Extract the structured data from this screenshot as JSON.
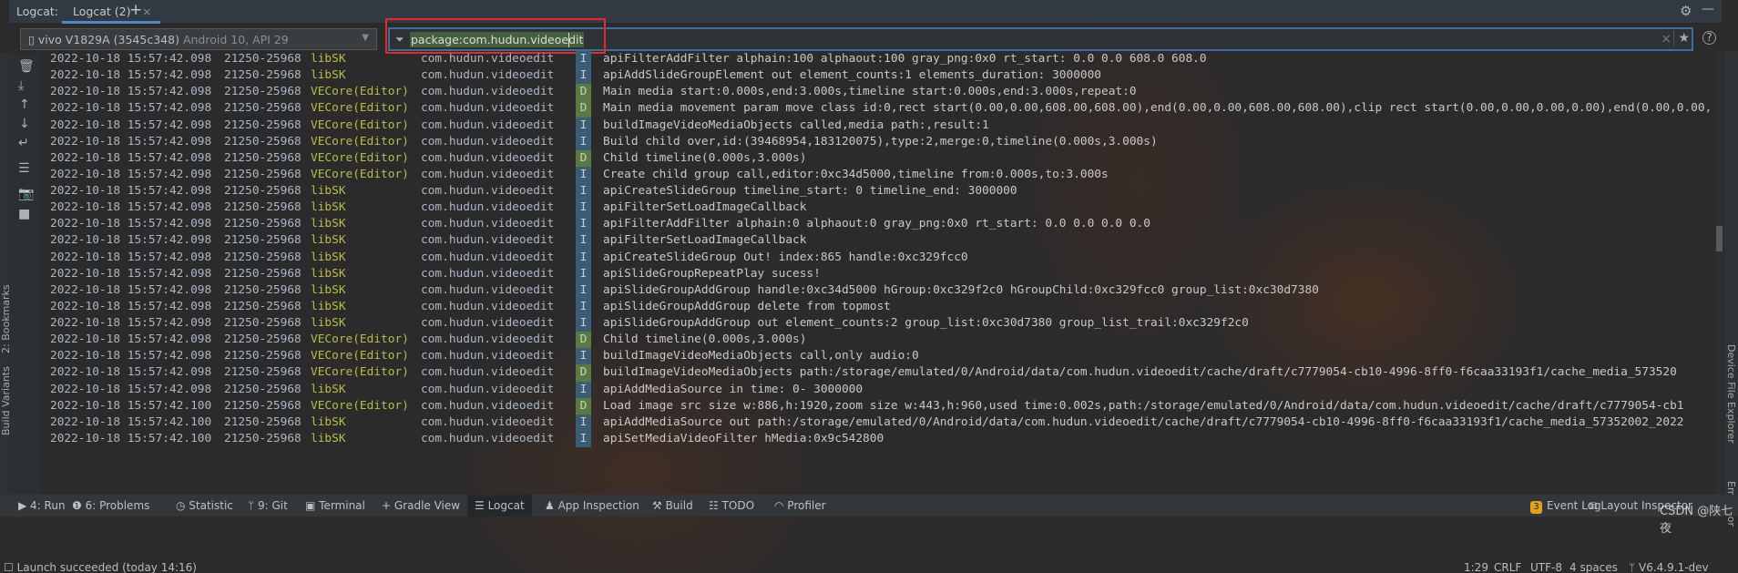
{
  "tabs": {
    "prefix": "Logcat:",
    "active": "Logcat (2)",
    "close": "×",
    "add": "+"
  },
  "header_icons": {
    "settings": "gear-icon",
    "minimize": "minimize-icon"
  },
  "device": {
    "name": "vivo V1829A (3545c348)",
    "os": "Android 10, API 29"
  },
  "filter": {
    "value": "package:com.hudun.videoedit",
    "highlight_color": "#e8282a"
  },
  "left_stripe": {
    "bookmarks": "2: Bookmarks",
    "build_variants": "Build Variants"
  },
  "right_stripe": {
    "device_file_explorer": "Device File Explorer",
    "emulator": "Emulator"
  },
  "log_rows": [
    {
      "date": "2022-10-18 15:57:42.098",
      "pid": "21250-25968",
      "tag": "libSK",
      "pkg": "com.hudun.videoedit",
      "level": "I",
      "msg": "apiFilterAddFilter alphain:100 alphaout:100 gray_png:0x0 rt_start: 0.0 0.0 608.0 608.0"
    },
    {
      "date": "2022-10-18 15:57:42.098",
      "pid": "21250-25968",
      "tag": "libSK",
      "pkg": "com.hudun.videoedit",
      "level": "I",
      "msg": "apiAddSlideGroupElement out element_counts:1 elements_duration: 3000000"
    },
    {
      "date": "2022-10-18 15:57:42.098",
      "pid": "21250-25968",
      "tag": "VECore(Editor)",
      "pkg": "com.hudun.videoedit",
      "level": "D",
      "msg": "Main media start:0.000s,end:3.000s,timeline start:0.000s,end:3.000s,repeat:0"
    },
    {
      "date": "2022-10-18 15:57:42.098",
      "pid": "21250-25968",
      "tag": "VECore(Editor)",
      "pkg": "com.hudun.videoedit",
      "level": "D",
      "msg": "Main media movement param move class id:0,rect start(0.00,0.00,608.00,608.00),end(0.00,0.00,608.00,608.00),clip rect start(0.00,0.00,0.00,0.00),end(0.00,0.00,"
    },
    {
      "date": "2022-10-18 15:57:42.098",
      "pid": "21250-25968",
      "tag": "VECore(Editor)",
      "pkg": "com.hudun.videoedit",
      "level": "I",
      "msg": "buildImageVideoMediaObjects called,media path:,result:1"
    },
    {
      "date": "2022-10-18 15:57:42.098",
      "pid": "21250-25968",
      "tag": "VECore(Editor)",
      "pkg": "com.hudun.videoedit",
      "level": "I",
      "msg": "Build child over,id:(39468954,183120075),type:2,merge:0,timeline(0.000s,3.000s)"
    },
    {
      "date": "2022-10-18 15:57:42.098",
      "pid": "21250-25968",
      "tag": "VECore(Editor)",
      "pkg": "com.hudun.videoedit",
      "level": "D",
      "msg": "Child timeline(0.000s,3.000s)"
    },
    {
      "date": "2022-10-18 15:57:42.098",
      "pid": "21250-25968",
      "tag": "VECore(Editor)",
      "pkg": "com.hudun.videoedit",
      "level": "I",
      "msg": "Create child group call,editor:0xc34d5000,timeline from:0.000s,to:3.000s"
    },
    {
      "date": "2022-10-18 15:57:42.098",
      "pid": "21250-25968",
      "tag": "libSK",
      "pkg": "com.hudun.videoedit",
      "level": "I",
      "msg": "apiCreateSlideGroup timeline_start: 0 timeline_end: 3000000"
    },
    {
      "date": "2022-10-18 15:57:42.098",
      "pid": "21250-25968",
      "tag": "libSK",
      "pkg": "com.hudun.videoedit",
      "level": "I",
      "msg": "apiFilterSetLoadImageCallback"
    },
    {
      "date": "2022-10-18 15:57:42.098",
      "pid": "21250-25968",
      "tag": "libSK",
      "pkg": "com.hudun.videoedit",
      "level": "I",
      "msg": "apiFilterAddFilter alphain:0 alphaout:0 gray_png:0x0 rt_start: 0.0 0.0 0.0 0.0"
    },
    {
      "date": "2022-10-18 15:57:42.098",
      "pid": "21250-25968",
      "tag": "libSK",
      "pkg": "com.hudun.videoedit",
      "level": "I",
      "msg": "apiFilterSetLoadImageCallback"
    },
    {
      "date": "2022-10-18 15:57:42.098",
      "pid": "21250-25968",
      "tag": "libSK",
      "pkg": "com.hudun.videoedit",
      "level": "I",
      "msg": "apiCreateSlideGroup Out! index:865 handle:0xc329fcc0"
    },
    {
      "date": "2022-10-18 15:57:42.098",
      "pid": "21250-25968",
      "tag": "libSK",
      "pkg": "com.hudun.videoedit",
      "level": "I",
      "msg": "apiSlideGroupRepeatPlay sucess!"
    },
    {
      "date": "2022-10-18 15:57:42.098",
      "pid": "21250-25968",
      "tag": "libSK",
      "pkg": "com.hudun.videoedit",
      "level": "I",
      "msg": "apiSlideGroupAddGroup handle:0xc34d5000 hGroup:0xc329f2c0 hGroupChild:0xc329fcc0 group_list:0xc30d7380"
    },
    {
      "date": "2022-10-18 15:57:42.098",
      "pid": "21250-25968",
      "tag": "libSK",
      "pkg": "com.hudun.videoedit",
      "level": "I",
      "msg": "apiSlideGroupAddGroup delete from topmost"
    },
    {
      "date": "2022-10-18 15:57:42.098",
      "pid": "21250-25968",
      "tag": "libSK",
      "pkg": "com.hudun.videoedit",
      "level": "I",
      "msg": "apiSlideGroupAddGroup out element_counts:2 group_list:0xc30d7380 group_list_trail:0xc329f2c0"
    },
    {
      "date": "2022-10-18 15:57:42.098",
      "pid": "21250-25968",
      "tag": "VECore(Editor)",
      "pkg": "com.hudun.videoedit",
      "level": "D",
      "msg": "Child timeline(0.000s,3.000s)"
    },
    {
      "date": "2022-10-18 15:57:42.098",
      "pid": "21250-25968",
      "tag": "VECore(Editor)",
      "pkg": "com.hudun.videoedit",
      "level": "I",
      "msg": "buildImageVideoMediaObjects call,only audio:0"
    },
    {
      "date": "2022-10-18 15:57:42.098",
      "pid": "21250-25968",
      "tag": "VECore(Editor)",
      "pkg": "com.hudun.videoedit",
      "level": "D",
      "msg": "buildImageVideoMediaObjects  path:/storage/emulated/0/Android/data/com.hudun.videoedit/cache/draft/c7779054-cb10-4996-8ff0-f6caa33193f1/cache_media_573520"
    },
    {
      "date": "2022-10-18 15:57:42.098",
      "pid": "21250-25968",
      "tag": "libSK",
      "pkg": "com.hudun.videoedit",
      "level": "I",
      "msg": "apiAddMediaSource in time: 0- 3000000"
    },
    {
      "date": "2022-10-18 15:57:42.100",
      "pid": "21250-25968",
      "tag": "VECore(Editor)",
      "pkg": "com.hudun.videoedit",
      "level": "D",
      "msg": "Load image src size w:886,h:1920,zoom size w:443,h:960,used time:0.002s,path:/storage/emulated/0/Android/data/com.hudun.videoedit/cache/draft/c7779054-cb1"
    },
    {
      "date": "2022-10-18 15:57:42.100",
      "pid": "21250-25968",
      "tag": "libSK",
      "pkg": "com.hudun.videoedit",
      "level": "I",
      "msg": "apiAddMediaSource out path:/storage/emulated/0/Android/data/com.hudun.videoedit/cache/draft/c7779054-cb10-4996-8ff0-f6caa33193f1/cache_media_57352002_2022"
    },
    {
      "date": "2022-10-18 15:57:42.100",
      "pid": "21250-25968",
      "tag": "libSK",
      "pkg": "com.hudun.videoedit",
      "level": "I",
      "msg": "apiSetMediaVideoFilter hMedia:0x9c542800"
    }
  ],
  "toolwindows": {
    "run": "4: Run",
    "problems": "6: Problems",
    "statistic": "Statistic",
    "git": "9: Git",
    "terminal": "Terminal",
    "gradle": "Gradle View",
    "logcat": "Logcat",
    "app_inspection": "App Inspection",
    "build": "Build",
    "todo": "TODO",
    "profiler": "Profiler",
    "event_log_count": "3",
    "event_log": "Event Log",
    "layout_inspector": "Layout Inspector"
  },
  "status": {
    "message": "Launch succeeded (today 14:16)",
    "position": "1:29",
    "line_sep": "CRLF",
    "encoding": "UTF-8",
    "indent": "4 spaces",
    "branch": "V6.4.9.1-dev"
  },
  "watermark": "CSDN @陕七夜",
  "colors": {
    "level_info": "#3a5d75",
    "level_debug": "#5b7a40",
    "tag": "#bcbc45",
    "accent": "#4a88c7"
  }
}
